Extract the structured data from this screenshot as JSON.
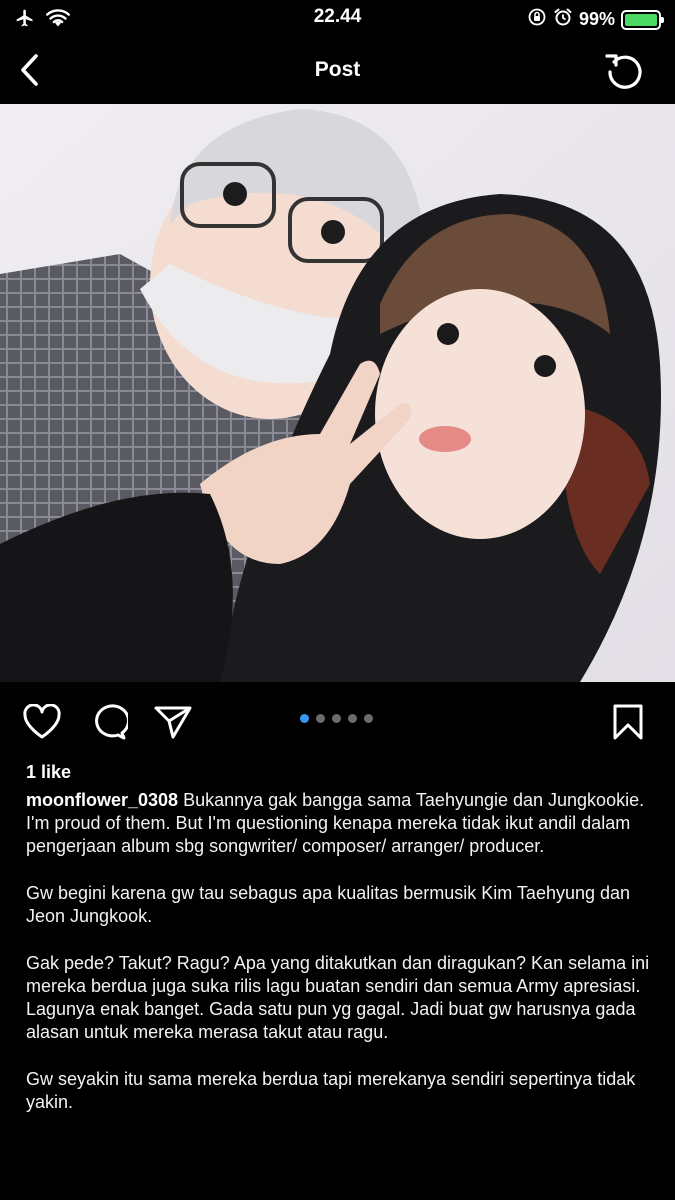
{
  "status_bar": {
    "time": "22.44",
    "battery_percent": "99%",
    "battery_level": 0.99,
    "icons": [
      "airplane-mode-icon",
      "wifi-icon",
      "orientation-lock-icon",
      "alarm-icon",
      "battery-charging-icon"
    ]
  },
  "nav": {
    "title": "Post",
    "back_icon": "chevron-left-icon",
    "refresh_icon": "refresh-icon"
  },
  "photo": {
    "icon": "post-photo"
  },
  "actions": {
    "icons": [
      "heart-icon",
      "comment-icon",
      "share-icon",
      "bookmark-icon"
    ],
    "carousel_count": 5,
    "carousel_active": 1,
    "accent": "#3897f0"
  },
  "likes": "1 like",
  "caption": {
    "username": "moonflower_0308",
    "paragraph_1": "Bukannya gak bangga sama Taehyungie dan Jungkookie. I'm proud of them. But I'm questioning kenapa mereka tidak ikut andil dalam pengerjaan album sbg songwriter/ composer/ arranger/ producer.",
    "paragraph_2": "Gw begini karena gw tau sebagus apa kualitas bermusik Kim Taehyung dan Jeon Jungkook.",
    "paragraph_3": "Gak pede? Takut? Ragu? Apa yang ditakutkan dan diragukan? Kan selama ini mereka berdua juga suka rilis lagu buatan sendiri dan semua Army apresiasi. Lagunya enak banget. Gada satu pun yg gagal. Jadi buat gw harusnya gada alasan untuk mereka merasa takut atau ragu.",
    "paragraph_4": "Gw seyakin itu sama mereka berdua tapi merekanya sendiri sepertinya tidak yakin."
  }
}
